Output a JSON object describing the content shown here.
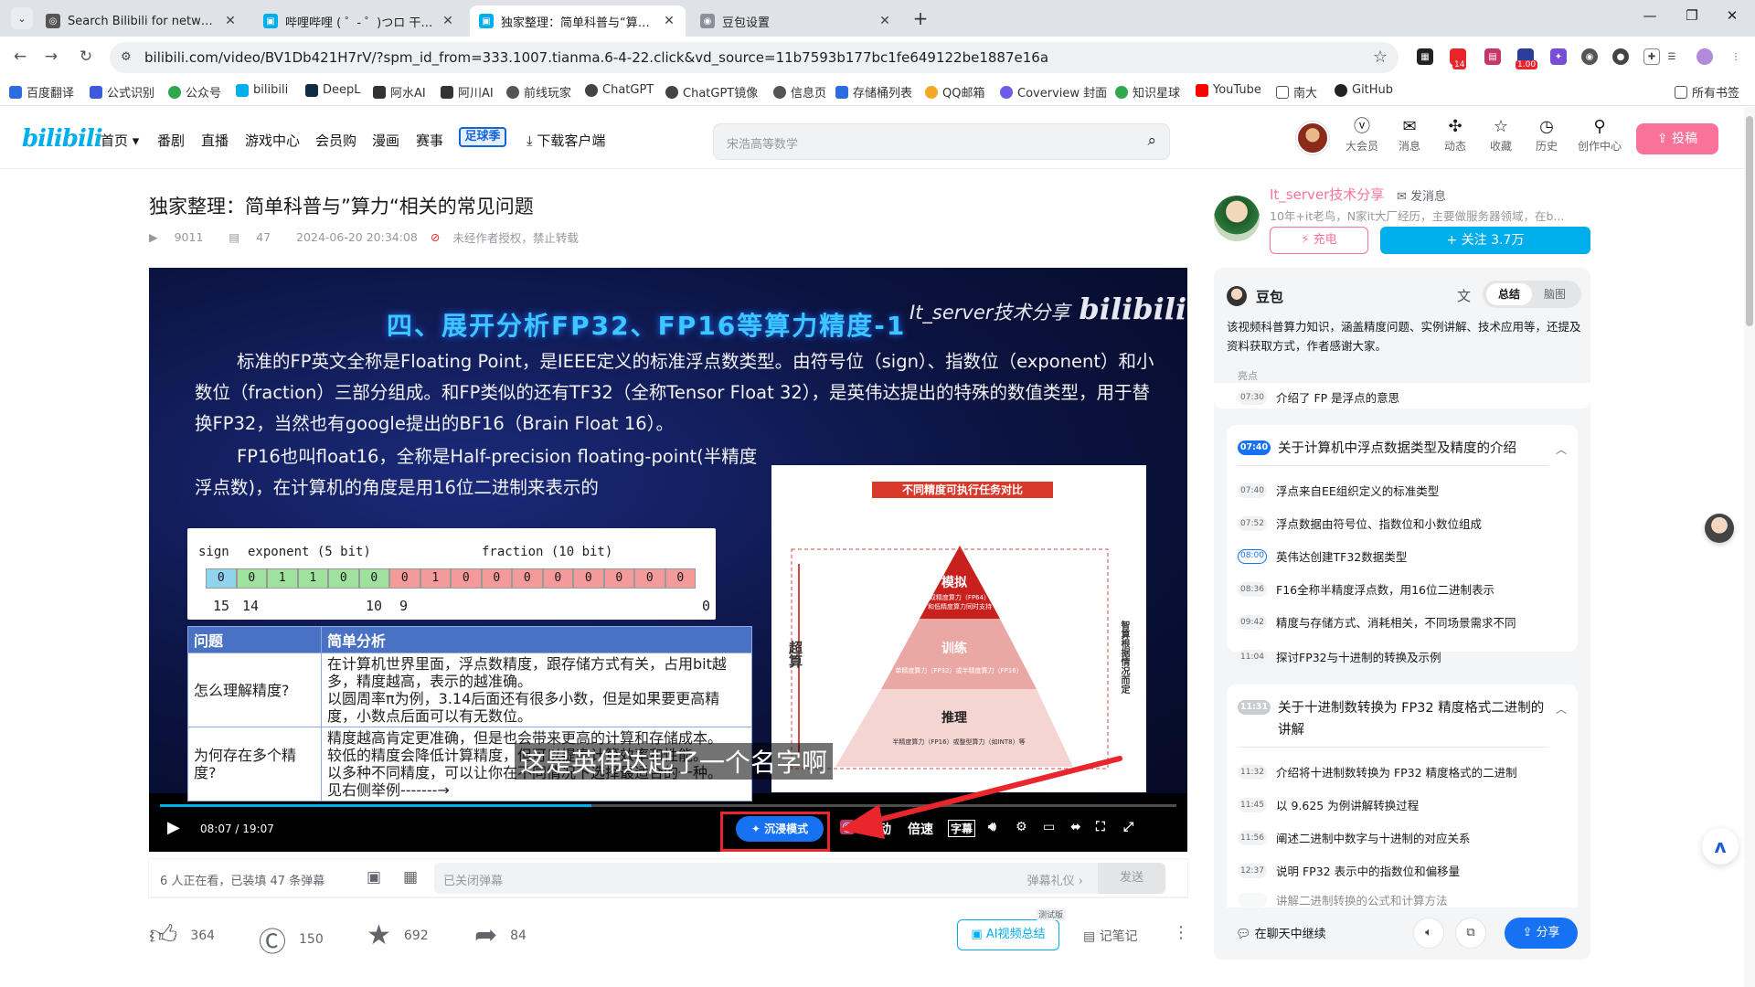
{
  "browser": {
    "tabs": [
      {
        "title": "Search Bilibili for networks",
        "active": false
      },
      {
        "title": "哔哩哔哩 ( ゜- ゜)つロ 干杯~-bi",
        "active": false
      },
      {
        "title": "独家整理：简单科普与“算力”相",
        "active": true
      },
      {
        "title": "豆包设置",
        "active": false
      }
    ],
    "url": "bilibili.com/video/BV1Db421H7rV/?spm_id_from=333.1007.tianma.6-4-22.click&vd_source=11b7593b177bc1fe649122be1887e16a",
    "ext_badges": [
      "14",
      "1.00"
    ],
    "bookmarks": [
      "百度翻译",
      "公式识别",
      "公众号",
      "bilibili",
      "DeepL",
      "阿水AI",
      "阿川AI",
      "前线玩家",
      "ChatGPT",
      "ChatGPT镜像",
      "信息页",
      "存储桶列表",
      "QQ邮箱",
      "Coverview 封面",
      "知识星球",
      "YouTube",
      "南大",
      "GitHub"
    ],
    "all_bookmarks": "所有书签"
  },
  "header": {
    "logo": "bilibili",
    "nav": [
      "首页 ▾",
      "番剧",
      "直播",
      "游戏中心",
      "会员购",
      "漫画",
      "赛事"
    ],
    "nav_badge": "足球季",
    "download": "下载客户端",
    "search_placeholder": "宋浩高等数学",
    "icons": [
      {
        "label": "大会员",
        "icon": "vip-icon"
      },
      {
        "label": "消息",
        "icon": "message-icon"
      },
      {
        "label": "动态",
        "icon": "dynamic-icon"
      },
      {
        "label": "收藏",
        "icon": "favorite-icon"
      },
      {
        "label": "历史",
        "icon": "history-icon"
      },
      {
        "label": "创作中心",
        "icon": "creator-icon"
      }
    ],
    "upload": "投稿"
  },
  "video": {
    "title": "独家整理：简单科普与”算力“相关的常见问题",
    "views": "9011",
    "danmaku": "47",
    "date": "2024-06-20 20:34:08",
    "copyright": "未经作者授权，禁止转载"
  },
  "slide": {
    "title": "四、展开分析FP32、FP16等算力精度-1",
    "watermark": "It_server技术分享",
    "watermark_logo": "bilibili",
    "para1": [
      "标准的FP英文全称是Floating Point，是IEEE定义的标准浮点数类型。由符号位（sign）、指数位（exponent）和小",
      "数位（fraction）三部分组成。和FP类似的还有TF32（全称Tensor Float 32），是英伟达提出的特殊的数值类型，用于替",
      "换FP32，当然也有google提出的BF16（Brain Float 16）。"
    ],
    "para2": [
      "FP16也叫float16，全称是Half-precision floating-point(半精度",
      "浮点数)，在计算机的角度是用16位二进制来表示的"
    ],
    "bits_labels": {
      "sign": "sign",
      "exponent": "exponent (5 bit)",
      "fraction": "fraction (10 bit)"
    },
    "bits": [
      "0",
      "0",
      "1",
      "1",
      "0",
      "0",
      "0",
      "1",
      "0",
      "0",
      "0",
      "0",
      "0",
      "0",
      "0",
      "0"
    ],
    "bit_numbers": [
      "15",
      "14",
      "10",
      "9",
      "0"
    ],
    "table_headers": [
      "问题",
      "简单分析"
    ],
    "table_rows": [
      {
        "q": "怎么理解精度?",
        "a": [
          "在计算机世界里面，浮点数精度，跟存储方式有关，占用bit越",
          "多，精度越高，表示的越准确。",
          "以圆周率π为例，3.14后面还有很多小数，但是如果要更高精",
          "度，小数点后面可以有无数位。"
        ]
      },
      {
        "q": "为何存在多个精度?",
        "a": [
          "精度越高肯定更准确，但是也会带来更高的计算和存储成本。",
          "较低的精度会降低计算精度，但可以提高计算效率和性能。",
          "以多种不同精度，可以让你在不同情况下选择最适合的一种。",
          "见右侧举例-------→"
        ]
      }
    ],
    "pyramid": {
      "title": "不同精度可执行任务对比",
      "left_label": "超算",
      "right_label": "智算根据情况而定",
      "levels": [
        {
          "name": "模拟",
          "sub": [
            "双精度算力（FP64）",
            "和低精度算力同时支持"
          ]
        },
        {
          "name": "训练",
          "sub": [
            "单精度算力（FP32）或半精度算力（FP16）"
          ]
        },
        {
          "name": "推理",
          "sub": [
            "半精度算力（FP16）或整型算力（如INT8）等"
          ]
        }
      ]
    },
    "caption": "这是英伟达起了一个名字啊"
  },
  "player": {
    "current": "08:07",
    "total": "19:07",
    "progress": 0.4245,
    "immersive": "沉浸模式",
    "controls": [
      "自动",
      "倍速",
      "字幕"
    ]
  },
  "danmaku_bar": {
    "count": "6 人正在看，已装填 47 条弹幕",
    "placeholder": "已关闭弹幕",
    "etiquette": "弹幕礼仪 ›",
    "send": "发送"
  },
  "actions": {
    "like": "364",
    "coin": "150",
    "favorite": "692",
    "share": "84",
    "ai_summary": "AI视频总结",
    "ai_badge": "测试版",
    "notes": "记笔记"
  },
  "uploader": {
    "name": "It_server技术分享",
    "message": "发消息",
    "desc": "10年+it老鸟，N家it大厂经历，主要做服务器领域，在b...",
    "charge": "充电",
    "follow": "+ 关注 3.7万"
  },
  "doubao": {
    "name": "豆包",
    "tabs": [
      "总结",
      "脑图"
    ],
    "summary": "该视频科普算力知识，涵盖精度问题、实例讲解、技术应用等，还提及资料获取方式，作者感谢大家。",
    "highlight_label": "亮点",
    "first_row": {
      "ts": "07:30",
      "text": "介绍了 FP 是浮点的意思"
    },
    "section1": {
      "ts": "07:40",
      "title": "关于计算机中浮点数据类型及精度的介绍",
      "items": [
        {
          "ts": "07:40",
          "text": "浮点来自EE组织定义的标准类型"
        },
        {
          "ts": "07:52",
          "text": "浮点数据由符号位、指数位和小数位组成"
        },
        {
          "ts": "08:00",
          "text": "英伟达创建TF32数据类型",
          "active": true
        },
        {
          "ts": "08:36",
          "text": "F16全称半精度浮点数，用16位二进制表示"
        },
        {
          "ts": "09:42",
          "text": "精度与存储方式、消耗相关，不同场景需求不同"
        },
        {
          "ts": "11:04",
          "text": "探讨FP32与十进制的转换及示例"
        }
      ]
    },
    "section2": {
      "ts": "11:31",
      "title": "关于十进制数转换为 FP32 精度格式二进制的讲解",
      "items": [
        {
          "ts": "11:32",
          "text": "介绍将十进制数转换为 FP32 精度格式的二进制"
        },
        {
          "ts": "11:45",
          "text": "以 9.625 为例讲解转换过程"
        },
        {
          "ts": "11:56",
          "text": "阐述二进制中数字与十进制的对应关系"
        },
        {
          "ts": "12:37",
          "text": "说明 FP32 表示中的指数位和偏移量"
        },
        {
          "ts": "",
          "text": "讲解二进制转换的公式和计算方法"
        }
      ]
    },
    "continue": "在聊天中继续",
    "share": "分享"
  }
}
